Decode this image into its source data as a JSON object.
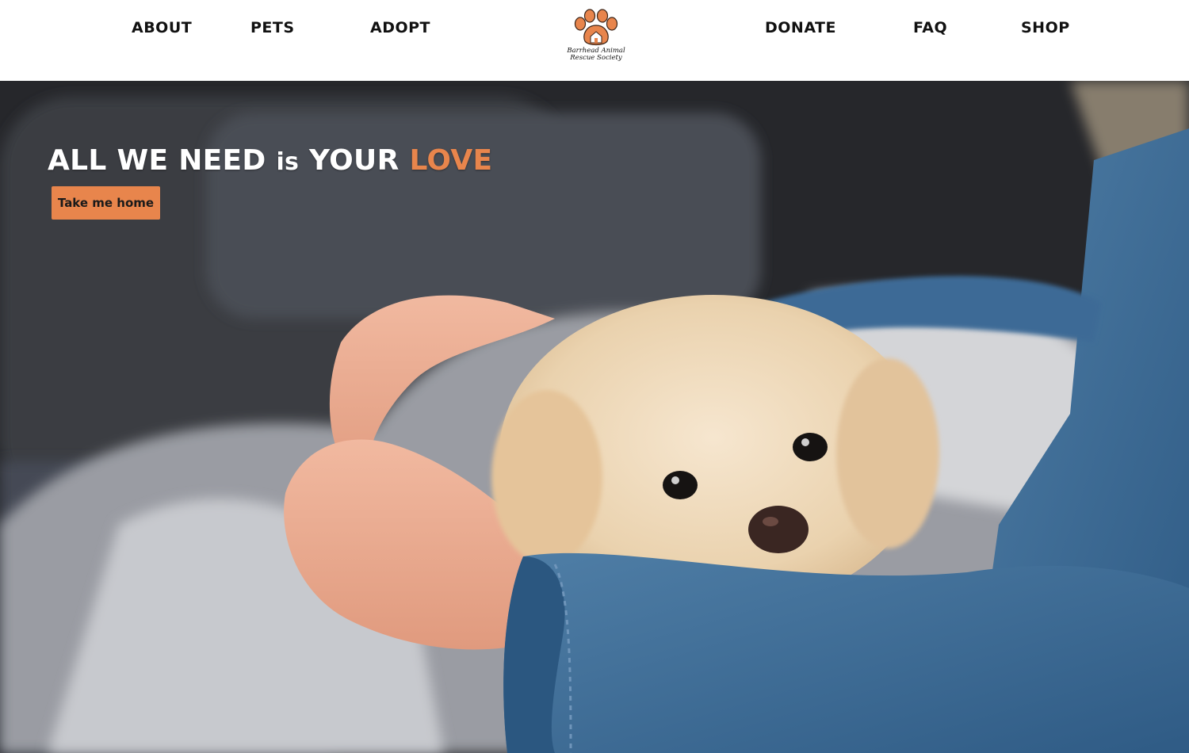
{
  "nav": {
    "left": [
      {
        "label": "ABOUT"
      },
      {
        "label": "PETS"
      },
      {
        "label": "ADOPT"
      }
    ],
    "right": [
      {
        "label": "DONATE"
      },
      {
        "label": "FAQ"
      },
      {
        "label": "SHOP"
      }
    ]
  },
  "logo": {
    "line1": "Barrhead Animal",
    "line2": "Rescue Society",
    "icon": "paw-house-icon"
  },
  "hero": {
    "headline": {
      "part1": "ALL WE NEED",
      "part2": "is",
      "part3": "YOUR",
      "part4": "LOVE"
    },
    "cta_label": "Take me home",
    "image": "puppy-in-arms-photo"
  },
  "colors": {
    "accent": "#e8854c",
    "nav_text": "#111111",
    "header_bg": "#ffffff"
  }
}
